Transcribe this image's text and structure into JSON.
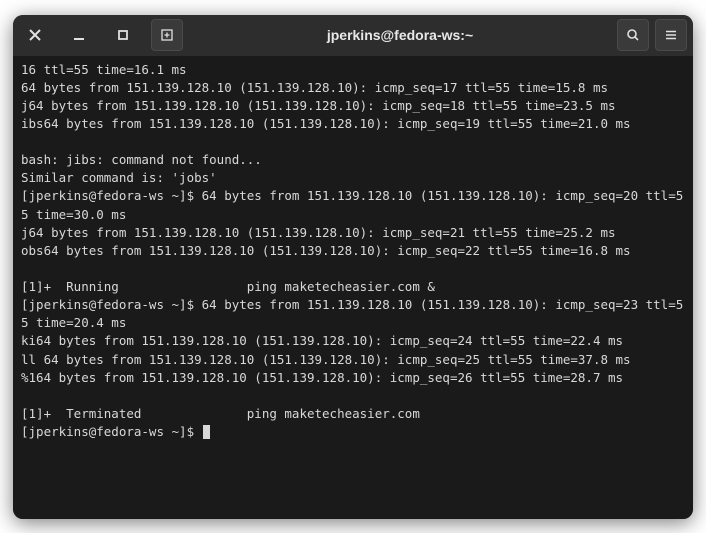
{
  "window": {
    "title": "jperkins@fedora-ws:~"
  },
  "terminal": {
    "lines": [
      "16 ttl=55 time=16.1 ms",
      "64 bytes from 151.139.128.10 (151.139.128.10): icmp_seq=17 ttl=55 time=15.8 ms",
      "j64 bytes from 151.139.128.10 (151.139.128.10): icmp_seq=18 ttl=55 time=23.5 ms",
      "ibs64 bytes from 151.139.128.10 (151.139.128.10): icmp_seq=19 ttl=55 time=21.0 ms",
      "",
      "bash: jibs: command not found...",
      "Similar command is: 'jobs'",
      "[jperkins@fedora-ws ~]$ 64 bytes from 151.139.128.10 (151.139.128.10): icmp_seq=20 ttl=55 time=30.0 ms",
      "j64 bytes from 151.139.128.10 (151.139.128.10): icmp_seq=21 ttl=55 time=25.2 ms",
      "obs64 bytes from 151.139.128.10 (151.139.128.10): icmp_seq=22 ttl=55 time=16.8 ms",
      "",
      "[1]+  Running                 ping maketecheasier.com &",
      "[jperkins@fedora-ws ~]$ 64 bytes from 151.139.128.10 (151.139.128.10): icmp_seq=23 ttl=55 time=20.4 ms",
      "ki64 bytes from 151.139.128.10 (151.139.128.10): icmp_seq=24 ttl=55 time=22.4 ms",
      "ll 64 bytes from 151.139.128.10 (151.139.128.10): icmp_seq=25 ttl=55 time=37.8 ms",
      "%164 bytes from 151.139.128.10 (151.139.128.10): icmp_seq=26 ttl=55 time=28.7 ms",
      "",
      "[1]+  Terminated              ping maketecheasier.com"
    ],
    "prompt": "[jperkins@fedora-ws ~]$ "
  }
}
